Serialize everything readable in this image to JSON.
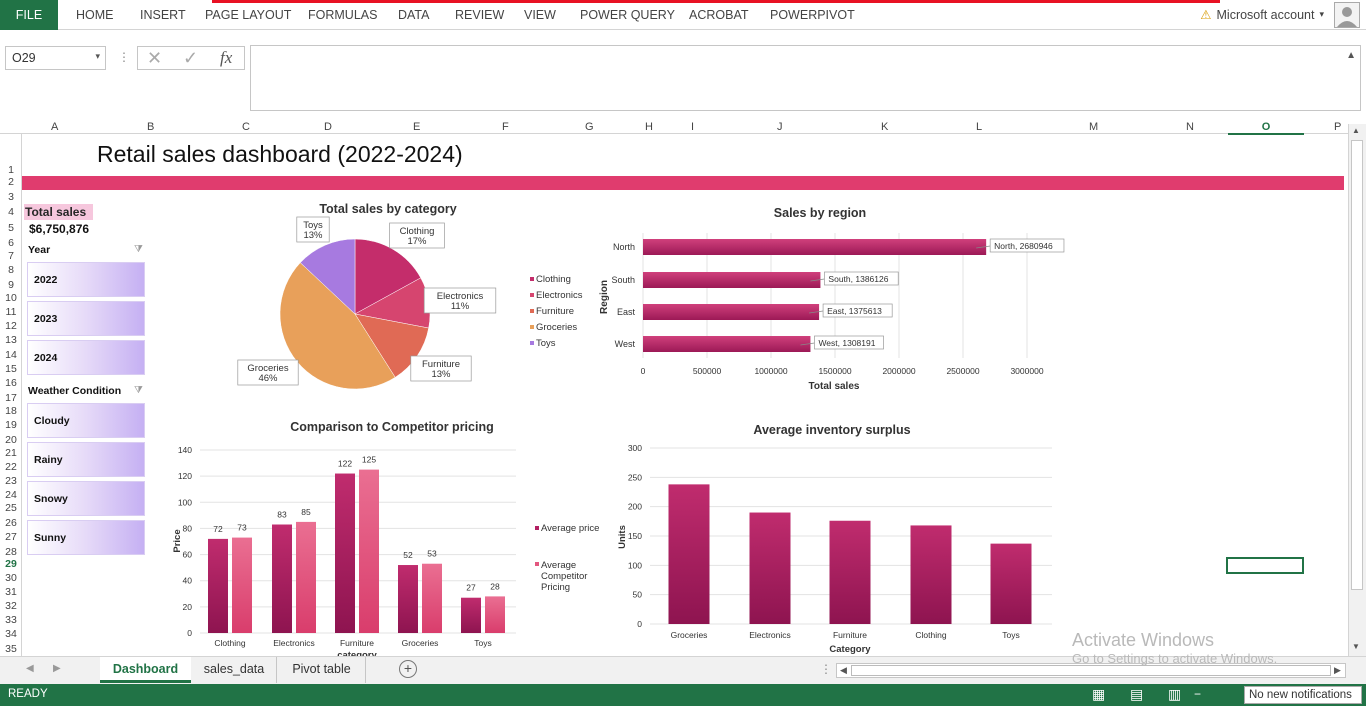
{
  "ribbon": {
    "file_tab": "FILE",
    "tabs": [
      "HOME",
      "INSERT",
      "PAGE LAYOUT",
      "FORMULAS",
      "DATA",
      "REVIEW",
      "VIEW",
      "POWER QUERY",
      "ACROBAT",
      "POWERPIVOT"
    ],
    "account": "Microsoft account"
  },
  "formula_bar": {
    "name_box": "O29",
    "fx": "fx",
    "formula": ""
  },
  "columns": [
    "A",
    "B",
    "C",
    "D",
    "E",
    "F",
    "G",
    "H",
    "I",
    "J",
    "K",
    "L",
    "M",
    "N",
    "O",
    "P"
  ],
  "rows": [
    "1",
    "2",
    "3",
    "4",
    "5",
    "6",
    "7",
    "8",
    "9",
    "10",
    "11",
    "12",
    "13",
    "14",
    "15",
    "16",
    "17",
    "18",
    "19",
    "20",
    "21",
    "22",
    "23",
    "24",
    "25",
    "26",
    "27",
    "28",
    "29",
    "30",
    "31",
    "32",
    "33",
    "34",
    "35"
  ],
  "dashboard": {
    "title": "Retail sales dashboard (2022-2024)",
    "total_sales_label": "Total sales",
    "total_sales_value": "$6,750,876"
  },
  "slicers": {
    "year": {
      "title": "Year",
      "items": [
        "2022",
        "2023",
        "2024"
      ]
    },
    "weather": {
      "title": "Weather Condition",
      "items": [
        "Cloudy",
        "Rainy",
        "Snowy",
        "Sunny"
      ]
    }
  },
  "chart_data": [
    {
      "type": "pie",
      "title": "Total sales by category",
      "categories": [
        "Clothing",
        "Electronics",
        "Furniture",
        "Groceries",
        "Toys"
      ],
      "values": [
        17,
        11,
        13,
        46,
        13
      ],
      "labels": [
        "17%",
        "11%",
        "13%",
        "46%",
        "13%"
      ],
      "colors": [
        "#c42d6b",
        "#d6456f",
        "#e06a55",
        "#e8a05a",
        "#a77ae0"
      ],
      "legend": "right"
    },
    {
      "type": "bar",
      "orientation": "horizontal",
      "title": "Sales by region",
      "categories": [
        "North",
        "South",
        "East",
        "West"
      ],
      "values": [
        2680946,
        1386126,
        1375613,
        1308191
      ],
      "data_labels": [
        "North, 2680946",
        "South, 1386126",
        "East, 1375613",
        "West, 1308191"
      ],
      "xlabel": "Total sales",
      "ylabel": "Region",
      "xlim": [
        0,
        3000000
      ],
      "ticks": [
        "0",
        "500000",
        "1000000",
        "1500000",
        "2000000",
        "2500000",
        "3000000"
      ],
      "color": "#c2266b"
    },
    {
      "type": "bar",
      "title": "Comparison to Competitor pricing",
      "categories": [
        "Clothing",
        "Electronics",
        "Furniture",
        "Groceries",
        "Toys"
      ],
      "series": [
        {
          "name": "Average price",
          "values": [
            72,
            83,
            122,
            52,
            27
          ],
          "color": "#b21f62"
        },
        {
          "name": "Average Competitor Pricing",
          "values": [
            73,
            85,
            125,
            53,
            28
          ],
          "color": "#e3567f"
        }
      ],
      "xlabel": "category",
      "ylabel": "Price",
      "ylim": [
        0,
        140
      ],
      "ticks": [
        "0",
        "20",
        "40",
        "60",
        "80",
        "100",
        "120",
        "140"
      ],
      "legend": "right"
    },
    {
      "type": "bar",
      "title": "Average inventory surplus",
      "categories": [
        "Groceries",
        "Electronics",
        "Furniture",
        "Clothing",
        "Toys"
      ],
      "values": [
        238,
        190,
        176,
        168,
        137
      ],
      "xlabel": "Category",
      "ylabel": "Units",
      "ylim": [
        0,
        300
      ],
      "ticks": [
        "0",
        "50",
        "100",
        "150",
        "200",
        "250",
        "300"
      ],
      "color": "#c2266b"
    }
  ],
  "sheets": [
    "Dashboard",
    "sales_data",
    "Pivot table"
  ],
  "status": {
    "ready": "READY",
    "notification": "No new notifications"
  },
  "watermark": {
    "line1": "Activate Windows",
    "line2": "Go to Settings to activate Windows."
  }
}
